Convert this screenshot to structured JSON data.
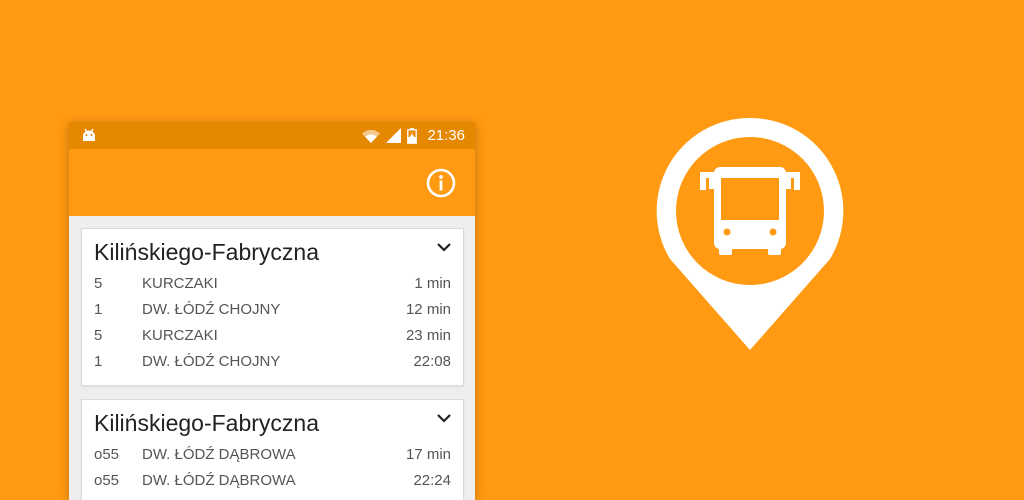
{
  "status_bar": {
    "time": "21:36",
    "icons": [
      "android-icon",
      "wifi-icon",
      "signal-icon",
      "battery-charging-icon"
    ]
  },
  "app_bar": {
    "info_icon": "info-icon"
  },
  "stops": [
    {
      "name": "Kilińskiego-Fabryczna",
      "departures": [
        {
          "line": "5",
          "destination": "KURCZAKI",
          "time": "1 min"
        },
        {
          "line": "1",
          "destination": "DW. ŁÓDŹ CHOJNY",
          "time": "12 min"
        },
        {
          "line": "5",
          "destination": "KURCZAKI",
          "time": "23 min"
        },
        {
          "line": "1",
          "destination": "DW. ŁÓDŹ CHOJNY",
          "time": "22:08"
        }
      ]
    },
    {
      "name": "Kilińskiego-Fabryczna",
      "departures": [
        {
          "line": "o55",
          "destination": "DW. ŁÓDŹ DĄBROWA",
          "time": "17 min"
        },
        {
          "line": "o55",
          "destination": "DW. ŁÓDŹ DĄBROWA",
          "time": "22:24"
        }
      ]
    }
  ],
  "logo": {
    "icon": "bus-stop-pin-icon"
  },
  "colors": {
    "background": "#FF9A12",
    "status_bar": "#E68700",
    "app_bar": "#FF9A12",
    "card": "#FFFFFF",
    "text_primary": "#222222",
    "text_secondary": "#555555"
  }
}
